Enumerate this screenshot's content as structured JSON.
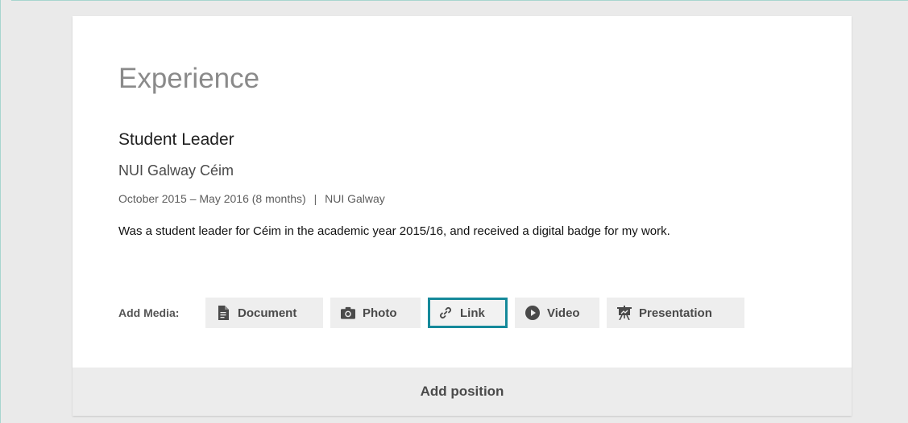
{
  "section": {
    "title": "Experience"
  },
  "position": {
    "title": "Student Leader",
    "company": "NUI Galway Céim",
    "dates": "October 2015 – May 2016 (8 months)",
    "separator": "|",
    "location": "NUI Galway",
    "description": "Was a student leader for Céim in the academic year 2015/16, and received a digital badge for my work."
  },
  "media": {
    "label": "Add Media:",
    "buttons": [
      {
        "label": "Document",
        "icon": "document-icon",
        "active": false
      },
      {
        "label": "Photo",
        "icon": "camera-icon",
        "active": false
      },
      {
        "label": "Link",
        "icon": "link-icon",
        "active": true
      },
      {
        "label": "Video",
        "icon": "play-icon",
        "active": false
      },
      {
        "label": "Presentation",
        "icon": "presentation-icon",
        "active": false
      }
    ]
  },
  "footer": {
    "add_position_label": "Add position"
  },
  "colors": {
    "active_outline": "#15899a",
    "page_background": "#eaeaea",
    "card_background": "#ffffff"
  }
}
